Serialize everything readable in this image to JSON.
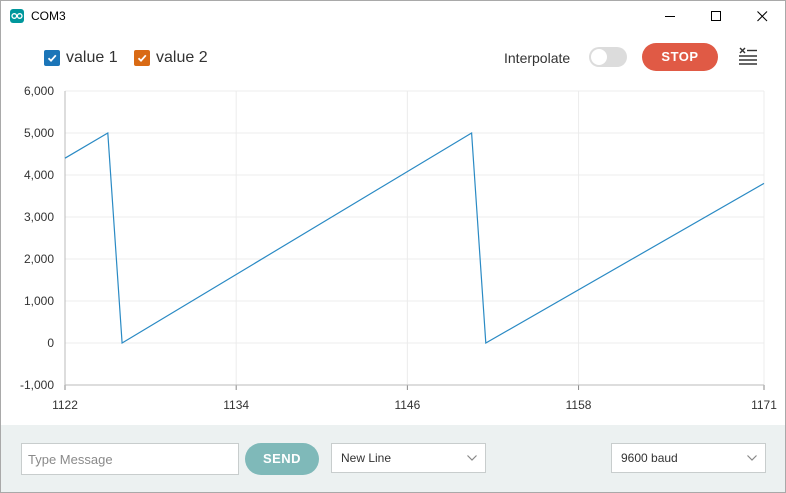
{
  "window": {
    "title": "COM3"
  },
  "toolbar": {
    "series": [
      {
        "label": "value 1",
        "color": "#1b75b8",
        "checked": true
      },
      {
        "label": "value 2",
        "color": "#d96a14",
        "checked": true
      }
    ],
    "interpolate_label": "Interpolate",
    "interpolate_on": false,
    "stop_label": "STOP"
  },
  "chart_data": {
    "type": "line",
    "xlim": [
      1122,
      1171
    ],
    "ylim": [
      -1000,
      6000
    ],
    "x_ticks": [
      "1122",
      "1134",
      "1146",
      "1158",
      "1171"
    ],
    "y_ticks": [
      "-1,000",
      "0",
      "1,000",
      "2,000",
      "3,000",
      "4,000",
      "5,000",
      "6,000"
    ],
    "grid": true,
    "series": [
      {
        "name": "value 1",
        "color": "#2a8ac4",
        "x": [
          1122,
          1125,
          1126,
          1150.5,
          1151.5,
          1171
        ],
        "y": [
          4400,
          5000,
          0,
          5000,
          0,
          3800
        ]
      }
    ]
  },
  "bottombar": {
    "message_placeholder": "Type Message",
    "send_label": "SEND",
    "line_ending": "New Line",
    "baud_rate": "9600 baud"
  }
}
